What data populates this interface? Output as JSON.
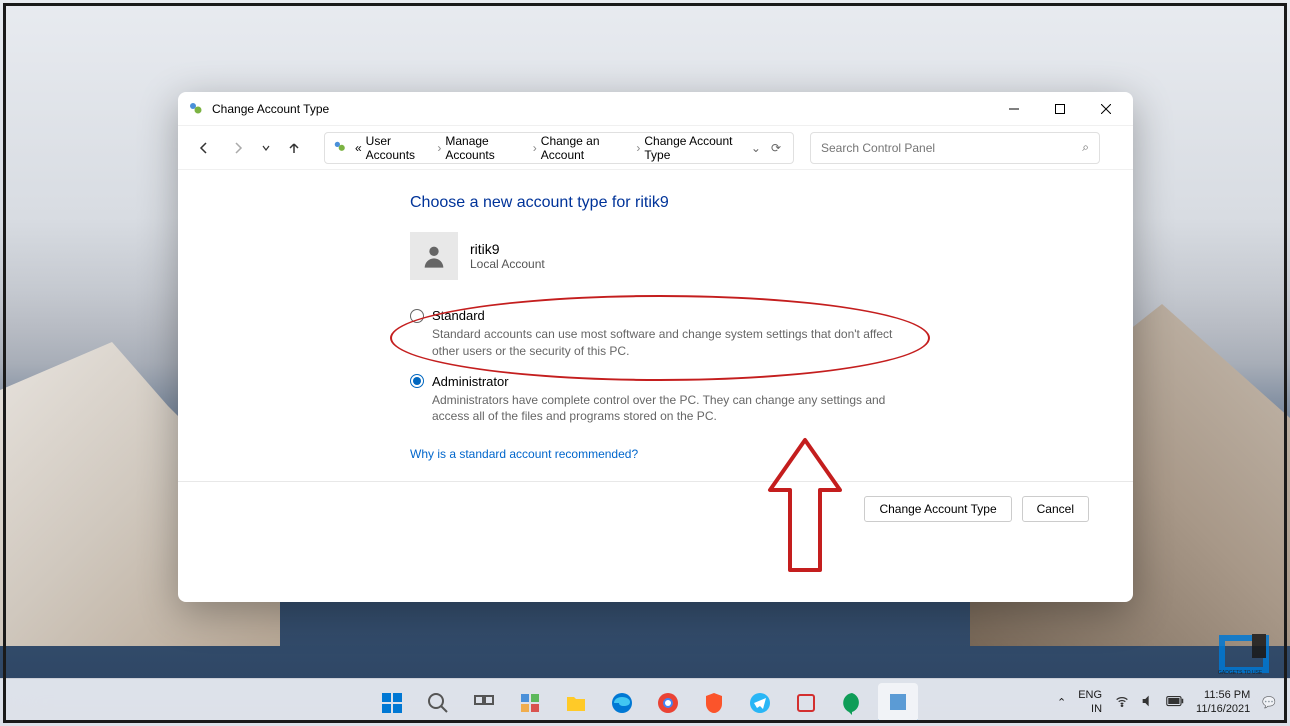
{
  "window": {
    "title": "Change Account Type",
    "breadcrumb": {
      "prefix": "«",
      "items": [
        "User Accounts",
        "Manage Accounts",
        "Change an Account",
        "Change Account Type"
      ]
    },
    "search_placeholder": "Search Control Panel"
  },
  "main": {
    "heading": "Choose a new account type for ritik9",
    "account_name": "ritik9",
    "account_subtype": "Local Account",
    "options": {
      "standard": {
        "label": "Standard",
        "desc": "Standard accounts can use most software and change system settings that don't affect other users or the security of this PC."
      },
      "administrator": {
        "label": "Administrator",
        "desc": "Administrators have complete control over the PC. They can change any settings and access all of the files and programs stored on the PC."
      }
    },
    "recommended_link": "Why is a standard account recommended?",
    "buttons": {
      "primary": "Change Account Type",
      "cancel": "Cancel"
    }
  },
  "taskbar": {
    "lang": "ENG",
    "lang_region": "IN",
    "time": "11:56 PM",
    "date": "11/16/2021"
  },
  "watermark": "GADGETS TO USE"
}
